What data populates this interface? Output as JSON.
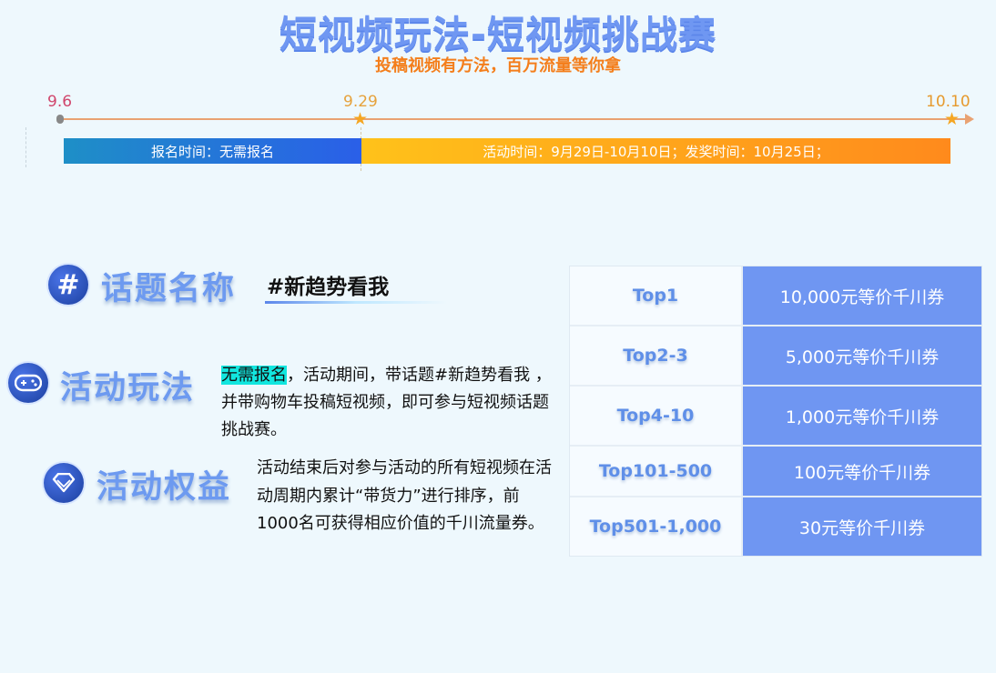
{
  "header": {
    "title": "短视频玩法-短视频挑战赛",
    "subtitle": "投稿视频有方法，百万流量等你拿"
  },
  "timeline": {
    "dates": [
      "9.6",
      "9.29",
      "10.10"
    ],
    "registration": "报名时间：无需报名",
    "activity": "活动时间：9月29日-10月10日；发奖时间：10月25日；"
  },
  "topic": {
    "heading": "话题名称",
    "icon": "hash-icon",
    "name": "#新趋势看我"
  },
  "play": {
    "heading": "活动玩法",
    "icon": "gamepad-icon",
    "highlight": "无需报名",
    "text": "，活动期间，带话题#新趋势看我 ，并带购物车投稿短视频，即可参与短视频话题挑战赛。"
  },
  "benefit": {
    "heading": "活动权益",
    "icon": "diamond-icon",
    "text": "活动结束后对参与活动的所有短视频在活动周期内累计“带货力”进行排序，前1000名可获得相应价值的千川流量券。"
  },
  "rewards": [
    {
      "rank": "Top1",
      "prize": "10,000元等价千川券"
    },
    {
      "rank": "Top2-3",
      "prize": "5,000元等价千川券"
    },
    {
      "rank": "Top4-10",
      "prize": "1,000元等价千川券"
    },
    {
      "rank": "Top101-500",
      "prize": "100元等价千川券"
    },
    {
      "rank": "Top501-1,000",
      "prize": "30元等价千川券"
    }
  ],
  "colors": {
    "title_blue": "#6f97f2",
    "subtitle_orange": "#f47e1b",
    "prize_blue": "#6f96f2",
    "highlight_cyan": "#12e6df"
  }
}
